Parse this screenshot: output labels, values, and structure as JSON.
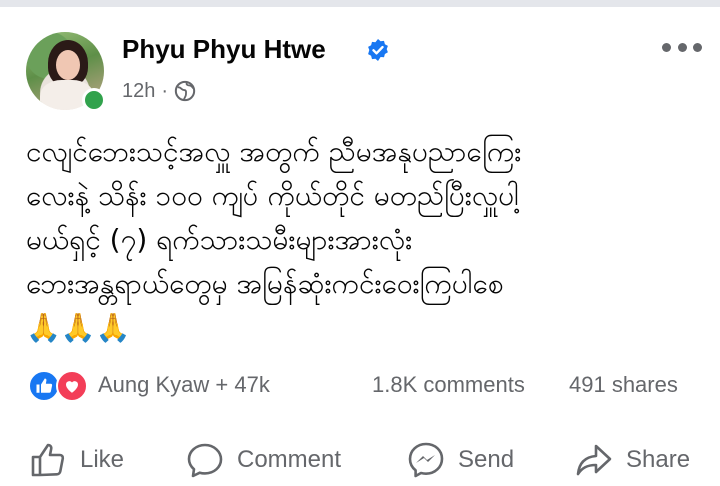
{
  "post": {
    "author_name": "Phyu Phyu Htwe",
    "timestamp": "12h",
    "separator": "·",
    "verified": true,
    "privacy_icon": "globe-icon",
    "menu_icon": "more-dots-icon",
    "text_lines": [
      "ငလျင်ဘေးသင့်အလှူ အတွက် ညီမအနုပညာကြေး",
      "လေးနဲ့ သိန်း ၁၀၀ ကျပ် ကိုယ်တိုင် မတည်ပြီးလှူပါ့",
      "မယ်ရှင့် (၇) ရက်သားသမီးများအားလုံး",
      "ဘေးအန္တရာယ်တွေမှ အမြန်ဆုံးကင်းဝေးကြပါစေ",
      "🙏🙏🙏"
    ]
  },
  "reactions": {
    "icons": [
      "like-reaction-icon",
      "love-reaction-icon"
    ],
    "names_text": "Aung Kyaw + 47k",
    "comments_text": "1.8K comments",
    "shares_text": "491 shares"
  },
  "actions": {
    "like_label": "Like",
    "comment_label": "Comment",
    "send_label": "Send",
    "share_label": "Share"
  },
  "colors": {
    "facebook_blue": "#1877f2",
    "love_red": "#f33e58",
    "online_green": "#31a24c",
    "secondary_text": "#65676b"
  }
}
